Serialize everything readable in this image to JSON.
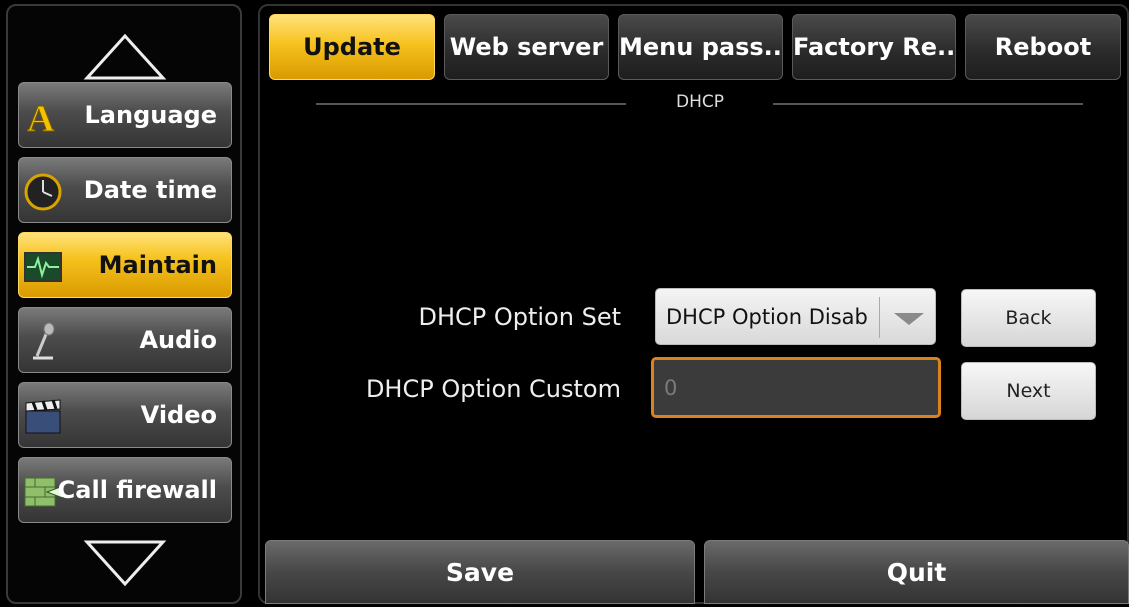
{
  "sidebar": {
    "items": [
      {
        "label": "Language",
        "icon": "letter-a-icon"
      },
      {
        "label": "Date time",
        "icon": "clock-icon"
      },
      {
        "label": "Maintain",
        "icon": "monitor-pulse-icon",
        "active": true
      },
      {
        "label": "Audio",
        "icon": "microphone-icon"
      },
      {
        "label": "Video",
        "icon": "clapperboard-icon"
      },
      {
        "label": "Call firewall",
        "icon": "firewall-icon"
      }
    ]
  },
  "tabs": [
    {
      "label": "Update",
      "active": true
    },
    {
      "label": "Web server"
    },
    {
      "label": "Menu pass..."
    },
    {
      "label": "Factory Re..."
    },
    {
      "label": "Reboot"
    }
  ],
  "section": {
    "title": "DHCP"
  },
  "form": {
    "option_set_label": "DHCP Option Set",
    "option_set_value": "DHCP Option Disab",
    "option_custom_label": "DHCP Option Custom",
    "option_custom_placeholder": "0"
  },
  "buttons": {
    "back": "Back",
    "next": "Next",
    "save": "Save",
    "quit": "Quit"
  },
  "colors": {
    "accent": "#f6c21d",
    "focus_border": "#d9821e"
  }
}
